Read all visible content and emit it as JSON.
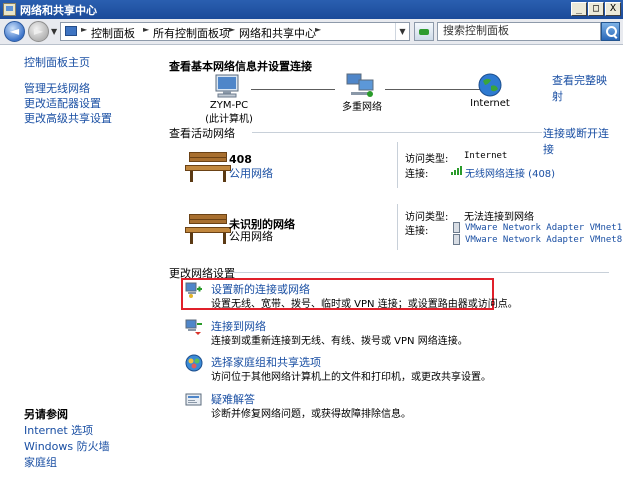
{
  "window": {
    "title": "网络和共享中心",
    "minimize": "_",
    "maximize": "□",
    "close": "X"
  },
  "addressbar": {
    "back": "◄",
    "forward": "►",
    "crumbs": [
      "控制面板",
      "所有控制面板项",
      "网络和共享中心"
    ],
    "search_placeholder": "搜索控制面板"
  },
  "sidebar": {
    "home": "控制面板主页",
    "links": [
      "管理无线网络",
      "更改适配器设置",
      "更改高级共享设置"
    ],
    "see_also_title": "另请参阅",
    "see_also": [
      "Internet 选项",
      "Windows 防火墙",
      "家庭组"
    ]
  },
  "map": {
    "header": "查看基本网络信息并设置连接",
    "full_map_link": "查看完整映射",
    "nodes": [
      {
        "label": "ZYM-PC",
        "sublabel": "(此计算机)",
        "icon": "computer-icon"
      },
      {
        "label": "多重网络",
        "icon": "network-icon"
      },
      {
        "label": "Internet",
        "icon": "globe-icon"
      }
    ]
  },
  "active": {
    "header": "查看活动网络",
    "connect_link": "连接或断开连接",
    "access_label": "访问类型:",
    "conn_label": "连接:",
    "networks": [
      {
        "name": "408",
        "type": "公用网络",
        "access_type": "Internet",
        "connections": [
          "无线网络连接 (408)"
        ]
      },
      {
        "name": "未识别的网络",
        "type": "公用网络",
        "access_type": "无法连接到网络",
        "connections": [
          "VMware Network Adapter VMnet1",
          "VMware Network Adapter VMnet8"
        ]
      }
    ]
  },
  "settings": {
    "header": "更改网络设置",
    "tasks": [
      {
        "title": "设置新的连接或网络",
        "desc": "设置无线、宽带、拨号、临时或 VPN 连接；或设置路由器或访问点。",
        "icon": "new-connection-icon",
        "highlighted": true
      },
      {
        "title": "连接到网络",
        "desc": "连接到或重新连接到无线、有线、拨号或 VPN 网络连接。",
        "icon": "connect-network-icon"
      },
      {
        "title": "选择家庭组和共享选项",
        "desc": "访问位于其他网络计算机上的文件和打印机，或更改共享设置。",
        "icon": "homegroup-icon"
      },
      {
        "title": "疑难解答",
        "desc": "诊断并修复网络问题，或获得故障排除信息。",
        "icon": "troubleshoot-icon"
      }
    ]
  },
  "colors": {
    "link": "#1a4fa3",
    "titlebar": "#2a5fb0",
    "highlight_border": "#e0202a"
  }
}
